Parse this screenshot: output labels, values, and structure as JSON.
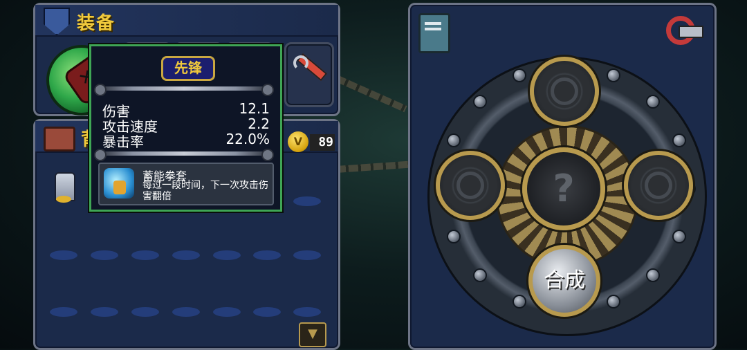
{
  "equipment": {
    "title": "装备"
  },
  "bag": {
    "title_fragment": "背",
    "coins": "89",
    "coin_symbol": "V"
  },
  "tooltip": {
    "item_name": "先锋",
    "stats": [
      {
        "label": "伤害",
        "value": "12.1"
      },
      {
        "label": "攻击速度",
        "value": "2.2"
      },
      {
        "label": "暴击率",
        "value": "22.0%"
      }
    ],
    "skill": {
      "name": "蓄能拳套",
      "description": "每过一段时间，下一次攻击伤害翻倍"
    }
  },
  "fusion": {
    "center_symbol": "?",
    "craft_label": "合成"
  },
  "colors": {
    "title_gold": "#f0c93c",
    "tooltip_border": "#3fa655",
    "panel_bg": "#1b2a4a"
  }
}
